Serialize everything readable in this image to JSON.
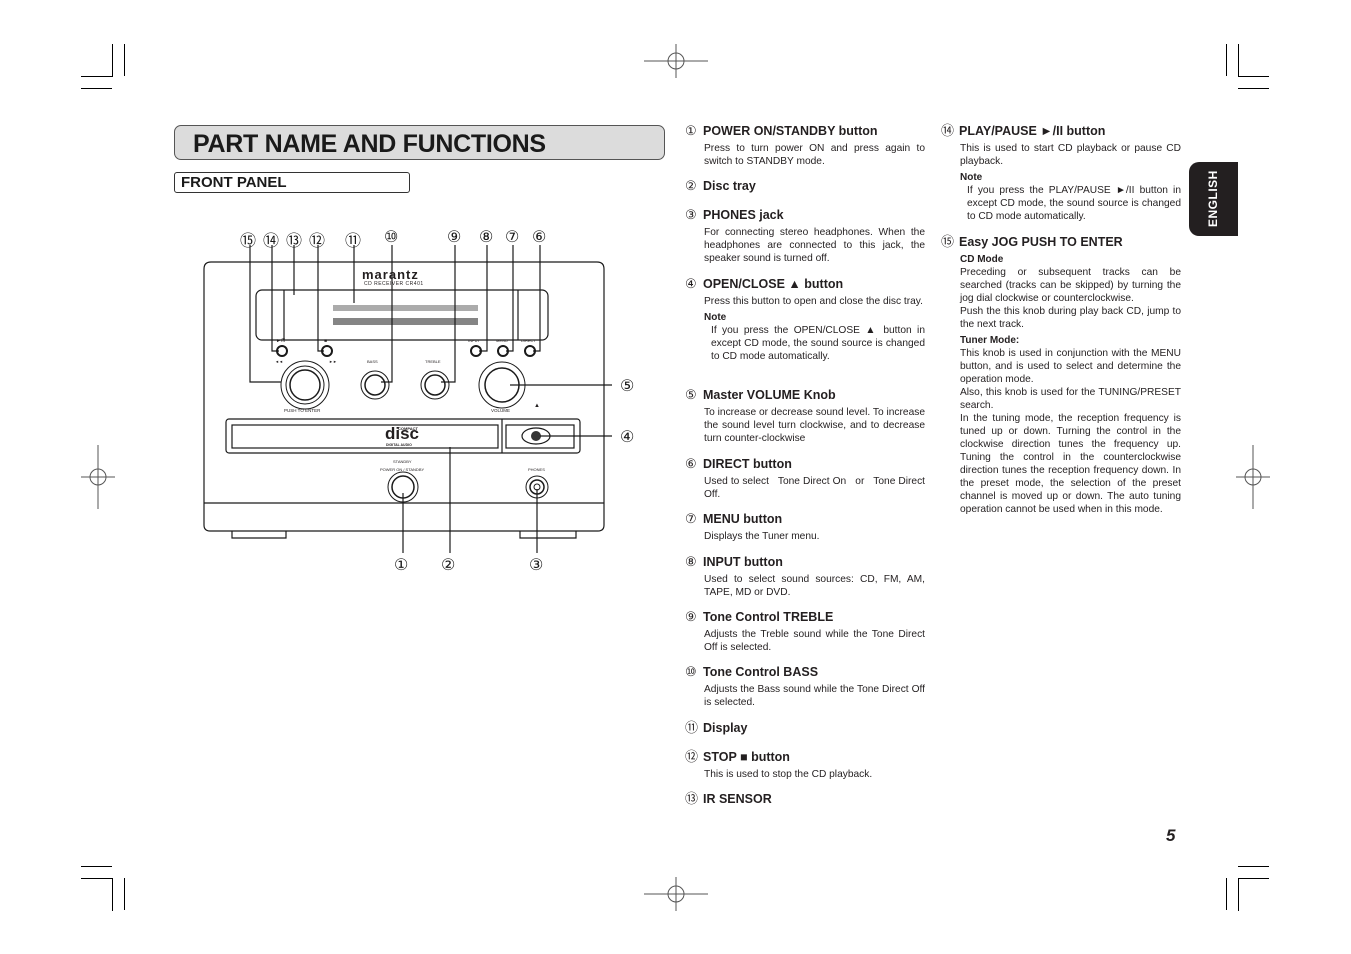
{
  "page": {
    "title": "PART NAME AND FUNCTIONS",
    "section": "FRONT PANEL",
    "language_tab": "ENGLISH",
    "page_number": "5"
  },
  "diagram": {
    "brand": "marantz",
    "model": "CD RECEIVER CR401",
    "labels": {
      "play_pause": "►/II",
      "stop": "■",
      "input": "INPUT",
      "menu": "MENU",
      "direct": "DIRECT",
      "bass": "BASS",
      "treble": "TREBLE",
      "push_to_enter": "PUSH TO ENTER",
      "volume": "VOLUME",
      "eject": "▲",
      "disc_logo_top": "COMPACT",
      "disc_logo_main": "disc",
      "disc_logo_bottom": "DIGITAL AUDIO",
      "standby": "STANDBY",
      "power": "POWER ON / STANDBY",
      "phones": "PHONES",
      "skip_back": "◄◄",
      "skip_fwd": "►►"
    },
    "callouts_top": [
      "⑮",
      "⑭",
      "⑬",
      "⑫",
      "⑪",
      "⑩",
      "⑨",
      "⑧",
      "⑦",
      "⑥"
    ],
    "callouts_right": [
      "⑤",
      "④"
    ],
    "callouts_bottom": [
      "①",
      "②",
      "③"
    ]
  },
  "items": [
    {
      "num": "①",
      "title": "POWER ON/STANDBY button",
      "body": "Press to turn power ON and press again to switch to STANDBY mode."
    },
    {
      "num": "②",
      "title": "Disc tray"
    },
    {
      "num": "③",
      "title": "PHONES jack",
      "body": "For connecting stereo headphones. When the headphones are connected to this jack, the speaker sound is turned off."
    },
    {
      "num": "④",
      "title": "OPEN/CLOSE ▲ button",
      "body": "Press this button to open and close the disc tray.",
      "note_label": "Note",
      "note": "If you press the OPEN/CLOSE ▲ button in except CD mode, the sound source is changed to CD mode automatically."
    },
    {
      "num": "⑤",
      "title": "Master VOLUME Knob",
      "body": "To increase or decrease sound level. To increase the sound level turn clockwise, and to decrease turn counter-clockwise"
    },
    {
      "num": "⑥",
      "title": "DIRECT button",
      "body": "Used to select   Tone Direct On   or   Tone Direct Off."
    },
    {
      "num": "⑦",
      "title": "MENU button",
      "body": "Displays the Tuner menu."
    },
    {
      "num": "⑧",
      "title": "INPUT button",
      "body": "Used to select sound sources: CD, FM, AM, TAPE, MD or DVD."
    },
    {
      "num": "⑨",
      "title": "Tone Control TREBLE",
      "body": "Adjusts the Treble sound while the Tone Direct Off is selected."
    },
    {
      "num": "⑩",
      "title": "Tone Control BASS",
      "body": "Adjusts the Bass sound while the Tone Direct Off is selected."
    },
    {
      "num": "⑪",
      "title": "Display"
    },
    {
      "num": "⑫",
      "title": "STOP ■ button",
      "body": "This is used to stop the CD playback."
    },
    {
      "num": "⑬",
      "title": "IR SENSOR"
    },
    {
      "num": "⑭",
      "title": "PLAY/PAUSE ►/II button",
      "body": "This is used to start CD playback or pause CD playback.",
      "note_label": "Note",
      "note": "If you press the PLAY/PAUSE ►/II button in except CD mode, the sound source is changed to CD mode automatically."
    },
    {
      "num": "⑮",
      "title": "Easy JOG PUSH TO ENTER",
      "cd_mode_label": "CD Mode",
      "cd_mode_1": "Preceding or subsequent tracks can be searched (tracks can be skipped) by turning the jog dial clockwise or counterclockwise.",
      "cd_mode_2": "Push the this knob during play back CD, jump to the next track.",
      "tuner_mode_label": "Tuner Mode:",
      "tuner_mode_1": "This knob is used in conjunction with the MENU button, and is used to select and determine the operation mode.",
      "tuner_mode_2": "Also, this knob is used for the TUNING/PRESET search.",
      "tuner_mode_3": "In the tuning mode, the reception frequency is tuned up or down. Turning the control in the clockwise direction tunes the frequency up. Tuning the control in the counterclockwise direction tunes the reception frequency down. In the preset mode, the selection of the preset channel is moved up or down. The auto tuning operation cannot be used when in this mode."
    }
  ]
}
